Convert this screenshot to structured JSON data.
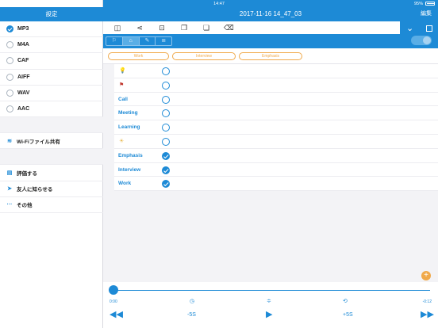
{
  "status": {
    "device": "iPad",
    "time": "14:47",
    "battery": "95%"
  },
  "sidebar": {
    "title": "設定",
    "formats": [
      {
        "label": "MP3",
        "selected": true
      },
      {
        "label": "M4A",
        "selected": false
      },
      {
        "label": "CAF",
        "selected": false
      },
      {
        "label": "AIFF",
        "selected": false
      },
      {
        "label": "WAV",
        "selected": false
      },
      {
        "label": "AAC",
        "selected": false
      }
    ],
    "wifi_label": "Wi-Fiファイル共有",
    "rate_label": "評価する",
    "tell_label": "友人に知らせる",
    "other_label": "その他"
  },
  "main": {
    "title": "2017-11-16 14_47_03",
    "edit_label": "編集",
    "tags": [
      "Work",
      "Interview",
      "Emphasis"
    ],
    "rows": [
      {
        "label": "",
        "icon": "lightbulb-icon",
        "checked": false
      },
      {
        "label": "",
        "icon": "flag-icon",
        "checked": false
      },
      {
        "label": "Call",
        "checked": false
      },
      {
        "label": "Meeting",
        "checked": false
      },
      {
        "label": "Learning",
        "checked": false
      },
      {
        "label": "",
        "icon": "sun-icon",
        "checked": false
      },
      {
        "label": "Emphasis",
        "checked": true
      },
      {
        "label": "Interview",
        "checked": true
      },
      {
        "label": "Work",
        "checked": true
      }
    ]
  },
  "player": {
    "elapsed": "0:00",
    "remaining": "-0:12",
    "back_label": "-5S",
    "fwd_label": "+5S",
    "progress": 0
  },
  "colors": {
    "accent": "#1d8ad6",
    "orange": "#f0a94a"
  }
}
